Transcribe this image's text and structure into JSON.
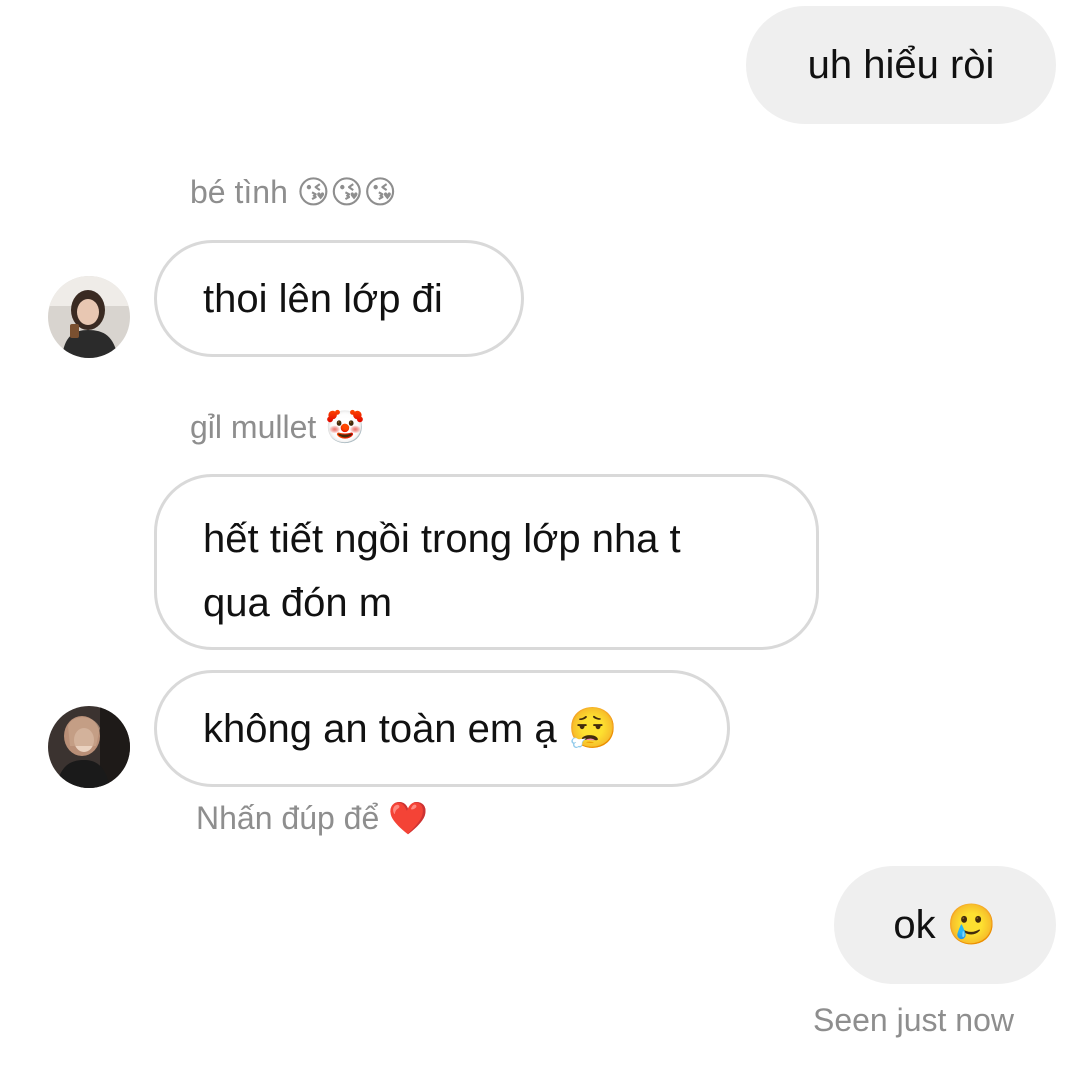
{
  "thread": {
    "messages": [
      {
        "id": "m1",
        "direction": "sent",
        "text": "uh hiểu ròi"
      },
      {
        "id": "m2",
        "direction": "received",
        "sender": "bé tình 😘😘😘",
        "text": "thoi lên lớp đi"
      },
      {
        "id": "m3",
        "direction": "received",
        "sender": "gỉl mullet 🤡",
        "text": "hết tiết ngồi trong lớp nha t\nqua đón m"
      },
      {
        "id": "m4",
        "direction": "received",
        "text": "không an toàn em ạ 😮‍💨"
      },
      {
        "id": "m5",
        "direction": "sent",
        "text": "ok 🥲"
      }
    ],
    "double_tap_hint": "Nhấn đúp để ❤️",
    "seen_status": "Seen just now"
  },
  "colors": {
    "sent_bubble": "#efefef",
    "received_border": "#d9d9d9",
    "meta_text": "#8e8e8e"
  }
}
